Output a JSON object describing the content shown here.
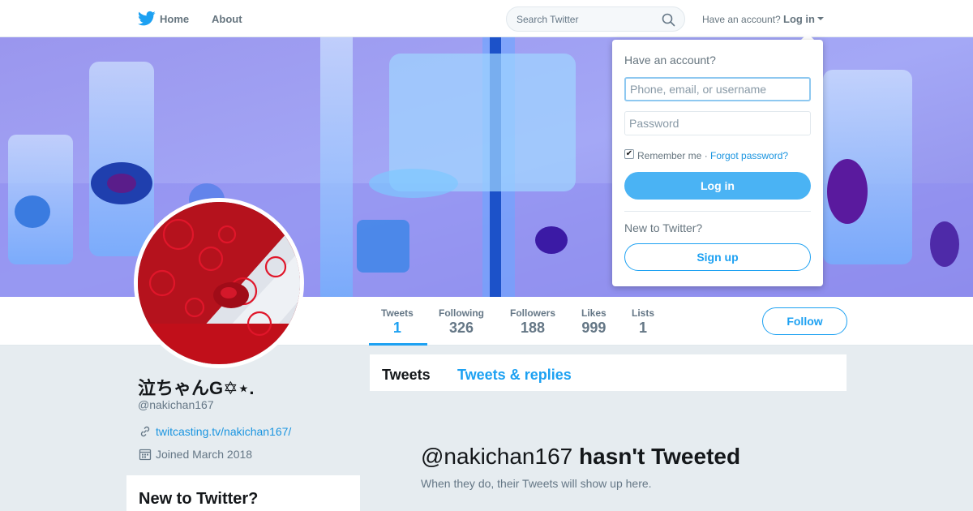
{
  "nav": {
    "logo_icon": "twitter-bird-icon",
    "home_label": "Home",
    "about_label": "About",
    "search_placeholder": "Search Twitter",
    "have_account_text": "Have an account?",
    "login_label": "Log in"
  },
  "profile": {
    "display_name": "泣ちゃんG✡⋆.",
    "screen_name": "@nakichan167",
    "url": "twitcasting.tv/nakichan167/",
    "joined": "Joined March 2018"
  },
  "stats": [
    {
      "label": "Tweets",
      "value": "1"
    },
    {
      "label": "Following",
      "value": "326"
    },
    {
      "label": "Followers",
      "value": "188"
    },
    {
      "label": "Likes",
      "value": "999"
    },
    {
      "label": "Lists",
      "value": "1"
    }
  ],
  "follow_label": "Follow",
  "timeline": {
    "tabs": [
      "Tweets",
      "Tweets & replies"
    ],
    "empty_handle": "@nakichan167",
    "empty_suffix": "hasn't Tweeted",
    "empty_sub": "When they do, their Tweets will show up here."
  },
  "side_card": {
    "title": "New to Twitter?"
  },
  "login_dropdown": {
    "title": "Have an account?",
    "phone_placeholder": "Phone, email, or username",
    "password_placeholder": "Password",
    "remember_label": "Remember me ·",
    "remember_checked": true,
    "forgot_label": "Forgot password?",
    "login_button": "Log in",
    "new_text": "New to Twitter?",
    "signup_button": "Sign up"
  },
  "colors": {
    "brand": "#1da1f2",
    "link": "#1b95e0",
    "background": "#e6ecf0"
  }
}
